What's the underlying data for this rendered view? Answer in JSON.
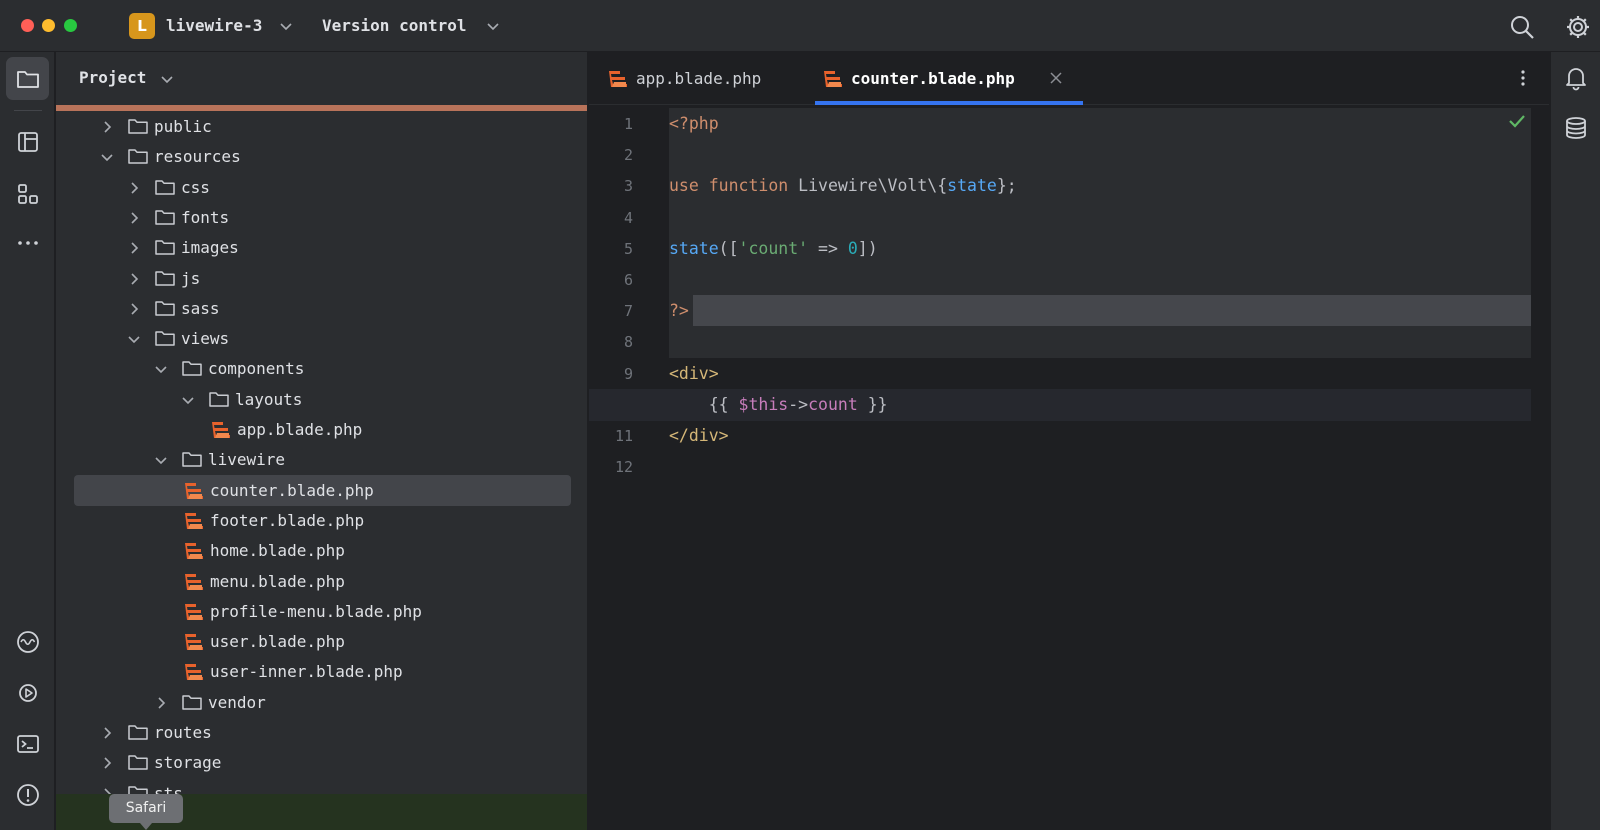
{
  "titlebar": {
    "project_badge": "L",
    "project_name": "livewire-3",
    "vcs_label": "Version control"
  },
  "left_stripe": {
    "icons": [
      "folder-icon",
      "structure-icon",
      "plugins-icon",
      "more-icon",
      "services-icon",
      "run-icon",
      "terminal-icon",
      "problems-icon"
    ]
  },
  "project_panel": {
    "title": "Project",
    "tree": [
      {
        "label": "public",
        "kind": "folder",
        "expanded": false,
        "depth": 0
      },
      {
        "label": "resources",
        "kind": "folder",
        "expanded": true,
        "depth": 0
      },
      {
        "label": "css",
        "kind": "folder",
        "expanded": false,
        "depth": 1
      },
      {
        "label": "fonts",
        "kind": "folder",
        "expanded": false,
        "depth": 1
      },
      {
        "label": "images",
        "kind": "folder",
        "expanded": false,
        "depth": 1
      },
      {
        "label": "js",
        "kind": "folder",
        "expanded": false,
        "depth": 1
      },
      {
        "label": "sass",
        "kind": "folder",
        "expanded": false,
        "depth": 1
      },
      {
        "label": "views",
        "kind": "folder",
        "expanded": true,
        "depth": 1
      },
      {
        "label": "components",
        "kind": "folder",
        "expanded": true,
        "depth": 2
      },
      {
        "label": "layouts",
        "kind": "folder",
        "expanded": true,
        "depth": 3
      },
      {
        "label": "app.blade.php",
        "kind": "file",
        "depth": 4
      },
      {
        "label": "livewire",
        "kind": "folder",
        "expanded": true,
        "depth": 2
      },
      {
        "label": "counter.blade.php",
        "kind": "file",
        "depth": 3,
        "selected": true
      },
      {
        "label": "footer.blade.php",
        "kind": "file",
        "depth": 3
      },
      {
        "label": "home.blade.php",
        "kind": "file",
        "depth": 3
      },
      {
        "label": "menu.blade.php",
        "kind": "file",
        "depth": 3
      },
      {
        "label": "profile-menu.blade.php",
        "kind": "file",
        "depth": 3
      },
      {
        "label": "user.blade.php",
        "kind": "file",
        "depth": 3
      },
      {
        "label": "user-inner.blade.php",
        "kind": "file",
        "depth": 3
      },
      {
        "label": "vendor",
        "kind": "folder",
        "expanded": false,
        "depth": 2
      },
      {
        "label": "routes",
        "kind": "folder",
        "expanded": false,
        "depth": 0
      },
      {
        "label": "storage",
        "kind": "folder",
        "expanded": false,
        "depth": 0
      },
      {
        "label": "sts",
        "kind": "folder",
        "expanded": false,
        "depth": 0
      }
    ],
    "tooltip": "Safari"
  },
  "editor": {
    "tabs": [
      {
        "label": "app.blade.php",
        "active": false
      },
      {
        "label": "counter.blade.php",
        "active": true
      }
    ],
    "current_line": 10,
    "lines": [
      [
        {
          "t": "<?php",
          "c": "k"
        }
      ],
      [],
      [
        {
          "t": "use function ",
          "c": "k"
        },
        {
          "t": "Livewire\\Volt\\{",
          "c": "plain"
        },
        {
          "t": "state",
          "c": "fn"
        },
        {
          "t": "};",
          "c": "plain"
        }
      ],
      [],
      [
        {
          "t": "state",
          "c": "fn"
        },
        {
          "t": "([",
          "c": "plain"
        },
        {
          "t": "'count'",
          "c": "str"
        },
        {
          "t": " => ",
          "c": "plain"
        },
        {
          "t": "0",
          "c": "num"
        },
        {
          "t": "])",
          "c": "plain"
        }
      ],
      [],
      [
        {
          "t": "?>",
          "c": "k"
        }
      ],
      [],
      [
        {
          "t": "<div>",
          "c": "tag"
        }
      ],
      [
        {
          "t": "    {{ ",
          "c": "plain"
        },
        {
          "t": "$this",
          "c": "var"
        },
        {
          "t": "->",
          "c": "plain"
        },
        {
          "t": "count",
          "c": "var"
        },
        {
          "t": " }}",
          "c": "plain"
        }
      ],
      [
        {
          "t": "</div>",
          "c": "tag"
        }
      ],
      []
    ]
  },
  "right_stripe": {
    "icons": [
      "notifications-icon",
      "database-icon"
    ]
  },
  "colors": {
    "accent": "#3574f0",
    "badge": "#d7961c",
    "progress": "#b8735a"
  }
}
